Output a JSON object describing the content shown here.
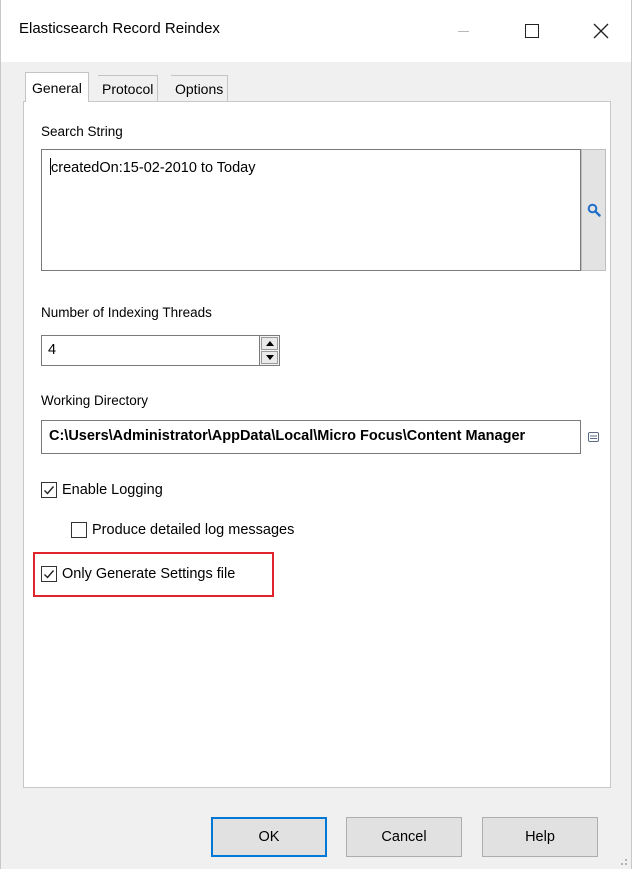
{
  "window": {
    "title": "Elasticsearch Record Reindex"
  },
  "tabs": [
    {
      "label": "General",
      "selected": true
    },
    {
      "label": "Protocol",
      "selected": false
    },
    {
      "label": "Options",
      "selected": false
    }
  ],
  "general": {
    "search_label": "Search String",
    "search_value": "createdOn:15-02-2010 to Today",
    "threads_label": "Number of Indexing Threads",
    "threads_value": "4",
    "directory_label": "Working Directory",
    "directory_value": "C:\\Users\\Administrator\\AppData\\Local\\Micro Focus\\Content Manager",
    "enable_logging": {
      "label": "Enable Logging",
      "checked": true
    },
    "detailed_log": {
      "label": "Produce detailed log messages",
      "checked": false
    },
    "only_settings": {
      "label": "Only Generate Settings file",
      "checked": true
    }
  },
  "buttons": {
    "ok": "OK",
    "cancel": "Cancel",
    "help": "Help"
  },
  "colors": {
    "accent": "#0078d7",
    "highlight": "#e0242c",
    "search_icon": "#1e6fc8"
  },
  "icons": {
    "search": "search-icon",
    "browse": "folder-browse-icon",
    "close": "close-icon",
    "maximize": "maximize-icon",
    "minimize": "minimize-icon"
  }
}
